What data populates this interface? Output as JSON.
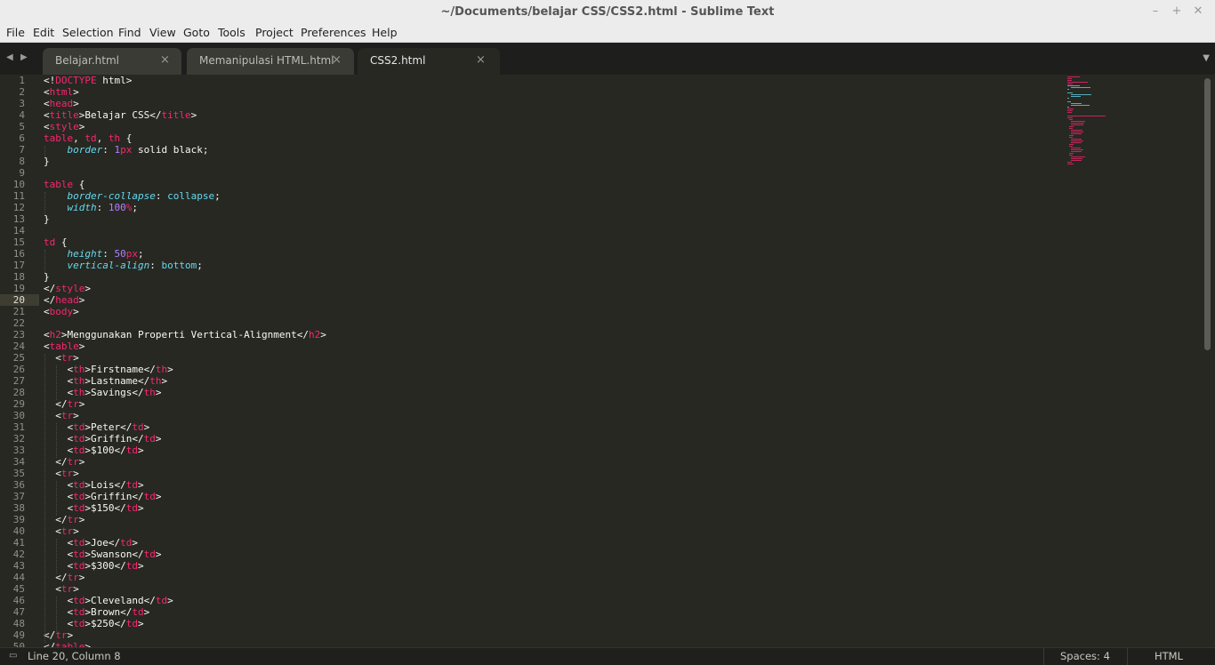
{
  "window": {
    "title": "~/Documents/belajar CSS/CSS2.html - Sublime Text",
    "minimize": "–",
    "maximize": "+",
    "close": "✕"
  },
  "menu": [
    "File",
    "Edit",
    "Selection",
    "Find",
    "View",
    "Goto",
    "Tools",
    "Project",
    "Preferences",
    "Help"
  ],
  "tabs": [
    {
      "label": "Belajar.html",
      "close": "×",
      "active": false
    },
    {
      "label": "Memanipulasi HTML.html",
      "close": "×",
      "active": false
    },
    {
      "label": "CSS2.html",
      "close": "×",
      "active": true
    }
  ],
  "editor": {
    "current_line": 20,
    "lines": [
      "<!DOCTYPE html>",
      "<html>",
      "<head>",
      "<title>Belajar CSS</title>",
      "<style>",
      "table, td, th {",
      "    border: 1px solid black;",
      "}",
      "",
      "table {",
      "    border-collapse: collapse;",
      "    width: 100%;",
      "}",
      "",
      "td {",
      "    height: 50px;",
      "    vertical-align: bottom;",
      "}",
      "</style>",
      "</head>",
      "<body>",
      "",
      "<h2>Menggunakan Properti Vertical-Alignment</h2>",
      "<table>",
      "  <tr>",
      "    <th>Firstname</th>",
      "    <th>Lastname</th>",
      "    <th>Savings</th>",
      "  </tr>",
      "  <tr>",
      "    <td>Peter</td>",
      "    <td>Griffin</td>",
      "    <td>$100</td>",
      "  </tr>",
      "  <tr>",
      "    <td>Lois</td>",
      "    <td>Griffin</td>",
      "    <td>$150</td>",
      "  </tr>",
      "  <tr>",
      "    <td>Joe</td>",
      "    <td>Swanson</td>",
      "    <td>$300</td>",
      "  </tr>",
      "  <tr>",
      "    <td>Cleveland</td>",
      "    <td>Brown</td>",
      "    <td>$250</td>",
      "</tr>",
      "</table>"
    ]
  },
  "status": {
    "position": "Line 20, Column 8",
    "indent": "Spaces: 4",
    "syntax": "HTML"
  },
  "colors": {
    "background": "#272822",
    "tag": "#f92672",
    "attribute": "#66d9ef",
    "number": "#ae81ff",
    "text": "#f8f8f2"
  }
}
